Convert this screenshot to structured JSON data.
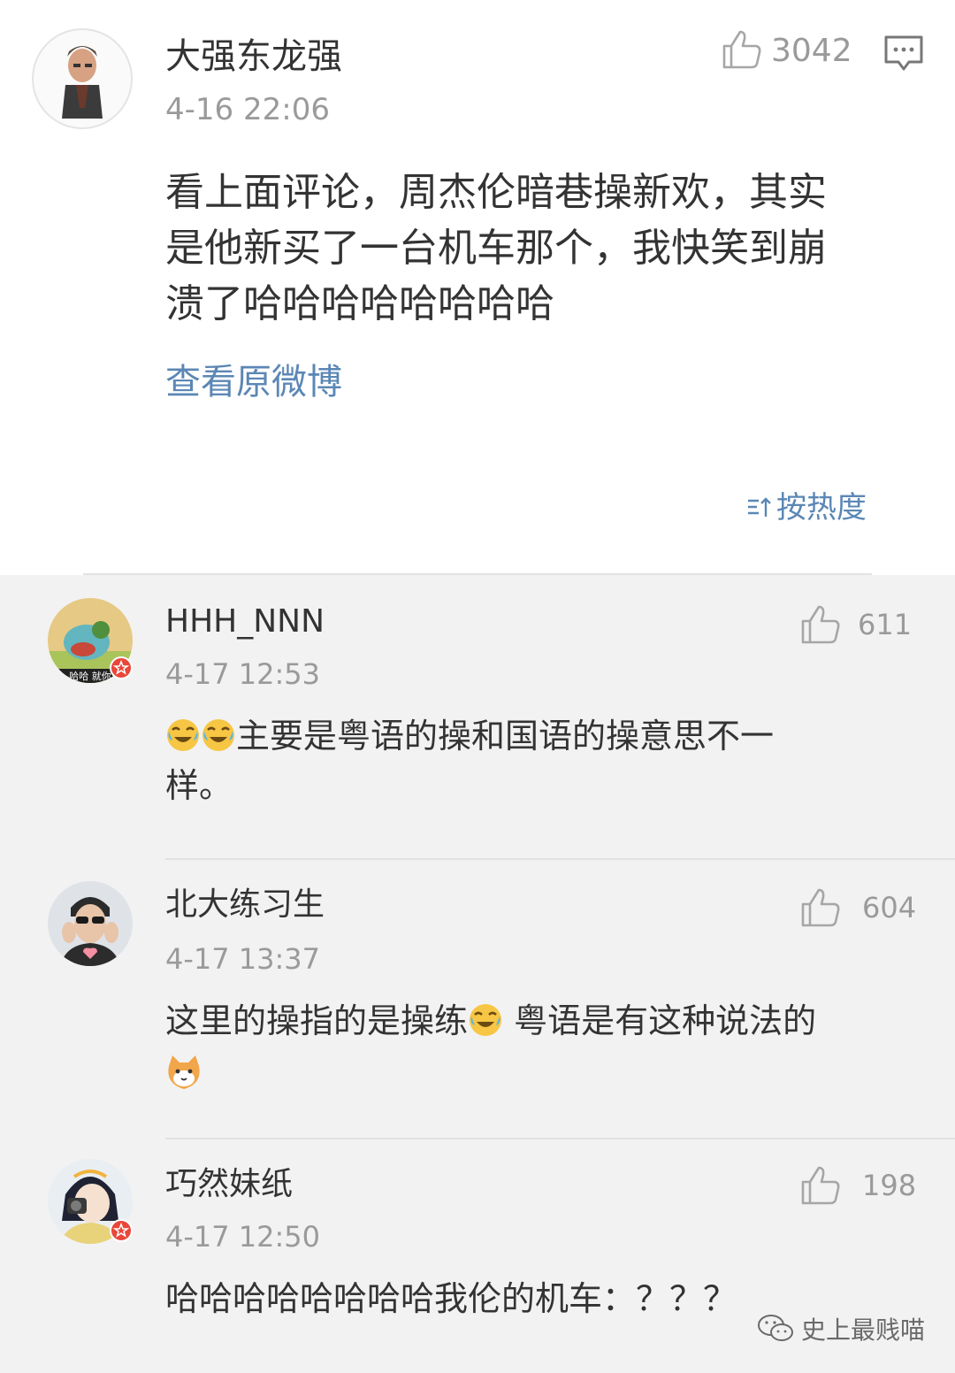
{
  "main_comment": {
    "user": "大强东龙强",
    "time": "4-16 22:06",
    "likes": "3042",
    "text_line1": "看上面评论，周杰伦暗巷操新欢，其实",
    "text_line2": "是他新买了一台机车那个，我快笑到崩",
    "text_line3": "溃了哈哈哈哈哈哈哈哈",
    "view_original": "查看原微博",
    "sort_label": "按热度"
  },
  "replies": [
    {
      "user": "HHH_NNN",
      "time": "4-17 12:53",
      "likes": "611",
      "text_line1": "主要是粤语的操和国语的操意思不一",
      "text_line2": "样。",
      "avatar_caption": "哈哈 就你"
    },
    {
      "user": "北大练习生",
      "time": "4-17 13:37",
      "likes": "604",
      "text_part1": "这里的操指的是操练",
      "text_part2": " 粤语是有这种说法的"
    },
    {
      "user": "巧然妹纸",
      "time": "4-17 12:50",
      "likes": "198",
      "text_line1": "哈哈哈哈哈哈哈哈我伦的机车：？？？"
    }
  ],
  "watermark": "史上最贱喵",
  "colors": {
    "link": "#5b87b5",
    "time": "#9a9a9a",
    "text": "#333333",
    "verified_badge": "#e8473a"
  },
  "icons": [
    "like-icon",
    "comment-icon",
    "sort-icon",
    "laugh-cry-emoji",
    "cat-emoji",
    "wechat-icon",
    "verified-badge-icon"
  ]
}
